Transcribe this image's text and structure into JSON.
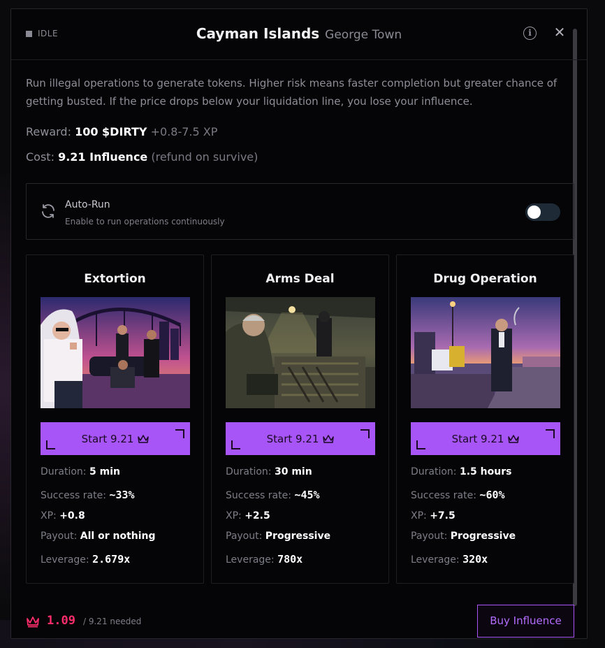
{
  "header": {
    "status": "IDLE",
    "title": "Cayman Islands",
    "subtitle": "George Town"
  },
  "description": "Run illegal operations to generate tokens. Higher risk means faster completion but greater chance of getting busted. If the price drops below your liquidation line, you lose your influence.",
  "reward": {
    "label": "Reward:",
    "amount": "100 $DIRTY",
    "xp": "+0.8-7.5 XP"
  },
  "cost": {
    "label": "Cost:",
    "amount": "9.21 Influence",
    "note": "(refund on survive)"
  },
  "autorun": {
    "title": "Auto-Run",
    "subtitle": "Enable to run operations continuously",
    "enabled": false
  },
  "labels": {
    "duration": "Duration:",
    "success": "Success rate:",
    "xp": "XP:",
    "payout": "Payout:",
    "leverage": "Leverage:"
  },
  "operations": [
    {
      "name": "Extortion",
      "start_label": "Start 9.21",
      "duration": "5 min",
      "success": "~33%",
      "xp": "+0.8",
      "payout": "All or nothing",
      "leverage": "2.679x"
    },
    {
      "name": "Arms Deal",
      "start_label": "Start 9.21",
      "duration": "30 min",
      "success": "~45%",
      "xp": "+2.5",
      "payout": "Progressive",
      "leverage": "780x"
    },
    {
      "name": "Drug Operation",
      "start_label": "Start 9.21",
      "duration": "1.5 hours",
      "success": "~60%",
      "xp": "+7.5",
      "payout": "Progressive",
      "leverage": "320x"
    }
  ],
  "footer": {
    "influence": "1.09",
    "needed": "/ 9.21 needed",
    "buy_label": "Buy Influence"
  },
  "colors": {
    "accent": "#a855f7",
    "danger": "#ff2d6b",
    "background": "#050507"
  }
}
